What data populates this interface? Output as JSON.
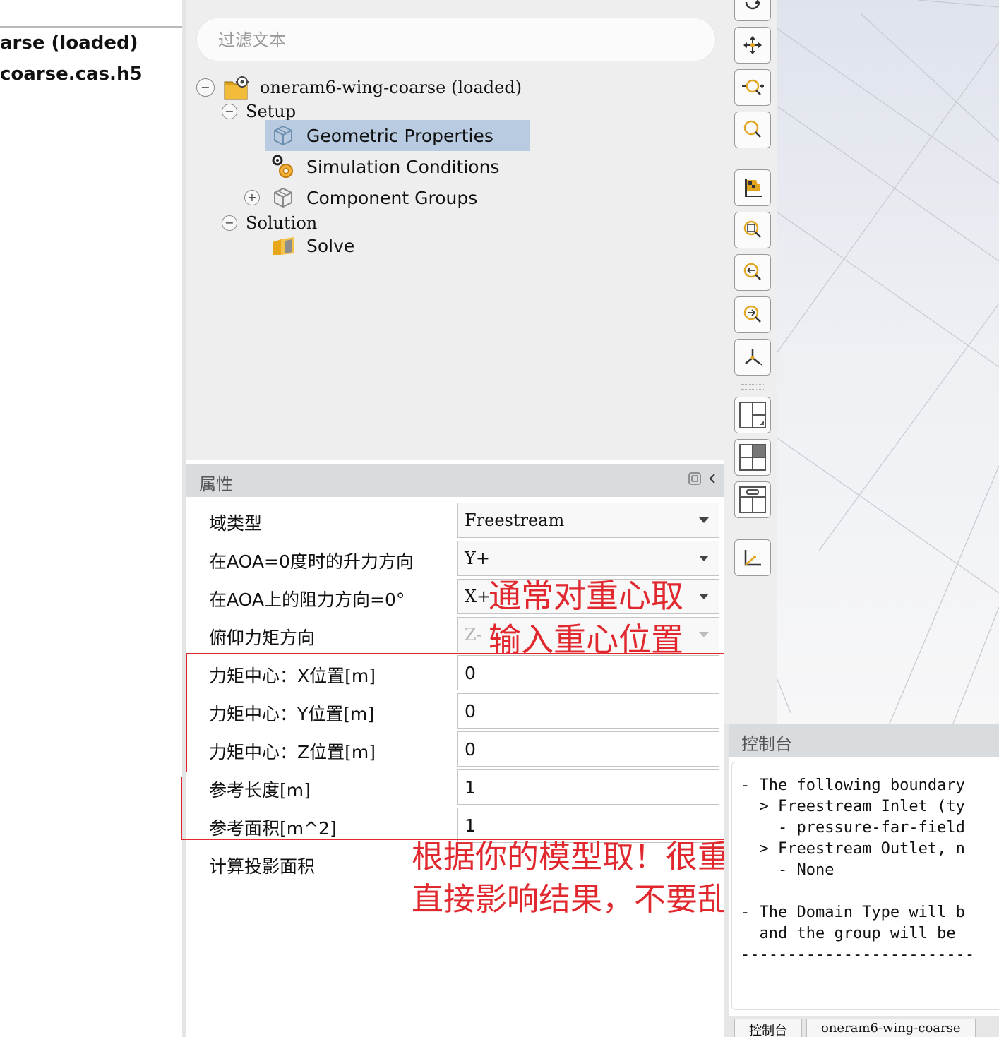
{
  "left_panel": {
    "line1": "arse (loaded)",
    "line2": "coarse.cas.h5"
  },
  "tree": {
    "filter_placeholder": "过滤文本",
    "root": {
      "label": "oneram6-wing-coarse (loaded)",
      "toggle": "−",
      "icon": "folder-gear-icon"
    },
    "setup": {
      "label": "Setup",
      "toggle": "−"
    },
    "setup_items": [
      {
        "label": "Geometric Properties",
        "icon": "cube-icon",
        "selected": true
      },
      {
        "label": "Simulation Conditions",
        "icon": "gears-icon",
        "selected": false
      },
      {
        "label": "Component Groups",
        "icon": "cube-icon",
        "toggle": "+",
        "selected": false
      }
    ],
    "solution": {
      "label": "Solution",
      "toggle": "−"
    },
    "solution_items": [
      {
        "label": "Solve",
        "icon": "solve-icon"
      }
    ]
  },
  "properties": {
    "title": "属性",
    "rows": [
      {
        "label": "域类型",
        "value": "Freestream",
        "kind": "select"
      },
      {
        "label": "在AOA=0度时的升力方向",
        "value": "Y+",
        "kind": "select"
      },
      {
        "label": "在AOA上的阻力方向=0°",
        "value": "X+",
        "kind": "select"
      },
      {
        "label": "俯仰力矩方向",
        "value": "Z-",
        "kind": "select-disabled"
      },
      {
        "label": "力矩中心：X位置[m]",
        "value": "0",
        "kind": "text"
      },
      {
        "label": "力矩中心：Y位置[m]",
        "value": "0",
        "kind": "text"
      },
      {
        "label": "力矩中心：Z位置[m]",
        "value": "0",
        "kind": "text"
      },
      {
        "label": "参考长度[m]",
        "value": "1",
        "kind": "text"
      },
      {
        "label": "参考面积[m^2]",
        "value": "1",
        "kind": "text"
      },
      {
        "label": "计算投影面积",
        "value": "",
        "kind": "none"
      }
    ]
  },
  "annotations": {
    "note1_line1": "通常对重心取",
    "note1_line2": "输入重心位置",
    "note2_line1": "根据你的模型取！很重要",
    "note2_line2": "直接影响结果，不要乱设",
    "color": "#e0282e"
  },
  "toolbar": {
    "buttons": [
      "rotate-icon",
      "pan-icon",
      "zoom-in-out-icon",
      "zoom-icon",
      "flag-icon",
      "zoom-box-icon",
      "zoom-prev-icon",
      "zoom-next-icon",
      "axes-icon",
      "layout-split-icon",
      "layout-quad-icon",
      "layout-top-icon",
      "axis-triad-icon"
    ]
  },
  "console": {
    "title": "控制台",
    "lines": [
      "- The following boundary",
      "  > Freestream Inlet (ty",
      "    - pressure-far-field",
      "  > Freestream Outlet, n",
      "    - None",
      "",
      "- The Domain Type will b",
      "  and the group will be",
      "-------------------------"
    ],
    "tabs": [
      "控制台",
      "oneram6-wing-coarse"
    ]
  }
}
